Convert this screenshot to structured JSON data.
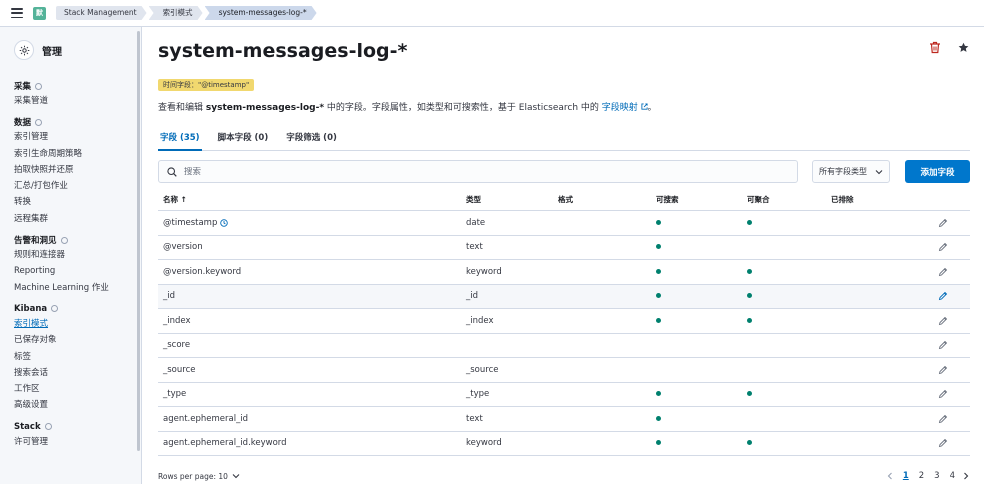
{
  "header": {
    "logo_letter": "默",
    "breadcrumbs": [
      "Stack Management",
      "索引模式",
      "system-messages-log-*"
    ]
  },
  "sidebar": {
    "title": "管理",
    "groups": [
      {
        "title": "采集",
        "items": [
          "采集管道"
        ]
      },
      {
        "title": "数据",
        "items": [
          "索引管理",
          "索引生命周期策略",
          "拍取快照并还原",
          "汇总/打包作业",
          "转换",
          "远程集群"
        ]
      },
      {
        "title": "告警和洞见",
        "items": [
          "规则和连接器",
          "Reporting",
          "Machine Learning 作业"
        ]
      },
      {
        "title": "Kibana",
        "items": [
          "索引模式",
          "已保存对象",
          "标签",
          "搜索会话",
          "工作区",
          "高级设置"
        ]
      },
      {
        "title": "Stack",
        "items": [
          "许可管理"
        ]
      }
    ],
    "active_item": "索引模式"
  },
  "main": {
    "title": "system-messages-log-*",
    "timestamp_badge": "时间字段：\"@timestamp\"",
    "description_prefix": "查看和编辑 ",
    "description_pattern": "system-messages-log-*",
    "description_mid": " 中的字段。字段属性，如类型和可搜索性，基于 Elasticsearch 中的 ",
    "description_link": "字段映射",
    "description_suffix": "。",
    "tabs": [
      "字段 (35)",
      "脚本字段 (0)",
      "字段筛选 (0)"
    ],
    "search_placeholder": "搜索",
    "type_filter": "所有字段类型",
    "add_field": "添加字段"
  },
  "table": {
    "columns": [
      "名称 ↑",
      "类型",
      "格式",
      "可搜索",
      "可聚合",
      "已排除"
    ],
    "rows": [
      {
        "name": "@timestamp",
        "type": "date",
        "searchable": true,
        "aggregatable": true,
        "clock": true
      },
      {
        "name": "@version",
        "type": "text",
        "searchable": true,
        "aggregatable": false
      },
      {
        "name": "@version.keyword",
        "type": "keyword",
        "searchable": true,
        "aggregatable": true
      },
      {
        "name": "_id",
        "type": "_id",
        "searchable": true,
        "aggregatable": true,
        "hover": true
      },
      {
        "name": "_index",
        "type": "_index",
        "searchable": true,
        "aggregatable": true
      },
      {
        "name": "_score",
        "type": "",
        "searchable": false,
        "aggregatable": false
      },
      {
        "name": "_source",
        "type": "_source",
        "searchable": false,
        "aggregatable": false
      },
      {
        "name": "_type",
        "type": "_type",
        "searchable": true,
        "aggregatable": true
      },
      {
        "name": "agent.ephemeral_id",
        "type": "text",
        "searchable": true,
        "aggregatable": false
      },
      {
        "name": "agent.ephemeral_id.keyword",
        "type": "keyword",
        "searchable": true,
        "aggregatable": true
      }
    ]
  },
  "footer": {
    "rows_per_page": "Rows per page: 10",
    "pages": [
      "1",
      "2",
      "3",
      "4"
    ],
    "current_page": "1"
  },
  "colors": {
    "accent": "#006bb8",
    "dot": "#00806e",
    "badge": "#f1d86f",
    "primary_button": "#0077cc"
  }
}
